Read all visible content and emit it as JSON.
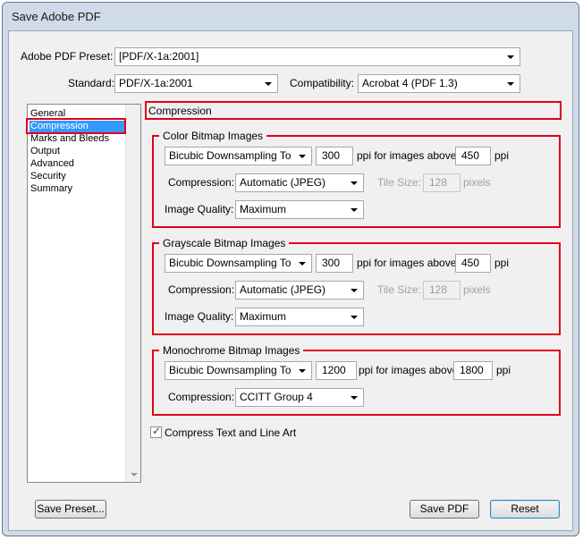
{
  "window": {
    "title": "Save Adobe PDF"
  },
  "preset": {
    "label": "Adobe PDF Preset:",
    "value": "[PDF/X-1a:2001]"
  },
  "standard": {
    "label": "Standard:",
    "value": "PDF/X-1a:2001"
  },
  "compatibility": {
    "label": "Compatibility:",
    "value": "Acrobat 4 (PDF 1.3)"
  },
  "sidebar": {
    "items": [
      {
        "label": "General",
        "selected": false
      },
      {
        "label": "Compression",
        "selected": true
      },
      {
        "label": "Marks and Bleeds",
        "selected": false
      },
      {
        "label": "Output",
        "selected": false
      },
      {
        "label": "Advanced",
        "selected": false
      },
      {
        "label": "Security",
        "selected": false
      },
      {
        "label": "Summary",
        "selected": false
      }
    ]
  },
  "panel": {
    "title": "Compression"
  },
  "color": {
    "title": "Color Bitmap Images",
    "downsampling": "Bicubic Downsampling To",
    "ppi": "300",
    "ppi_label": "ppi for images above",
    "above": "450",
    "ppi_unit": "ppi",
    "compression_label": "Compression:",
    "compression": "Automatic (JPEG)",
    "tile_label": "Tile Size:",
    "tile": "128",
    "tile_unit": "pixels",
    "quality_label": "Image Quality:",
    "quality": "Maximum"
  },
  "gray": {
    "title": "Grayscale Bitmap Images",
    "downsampling": "Bicubic Downsampling To",
    "ppi": "300",
    "ppi_label": "ppi for images above",
    "above": "450",
    "ppi_unit": "ppi",
    "compression_label": "Compression:",
    "compression": "Automatic (JPEG)",
    "tile_label": "Tile Size:",
    "tile": "128",
    "tile_unit": "pixels",
    "quality_label": "Image Quality:",
    "quality": "Maximum"
  },
  "mono": {
    "title": "Monochrome Bitmap Images",
    "downsampling": "Bicubic Downsampling To",
    "ppi": "1200",
    "ppi_label": "ppi for images above",
    "above": "1800",
    "ppi_unit": "ppi",
    "compression_label": "Compression:",
    "compression": "CCITT Group 4"
  },
  "compress_text": {
    "label": "Compress Text and Line Art",
    "checked": true
  },
  "buttons": {
    "save_preset": "Save Preset...",
    "save_pdf": "Save PDF",
    "reset": "Reset"
  },
  "colors": {
    "highlight": "#e0001a",
    "selection": "#3399ff"
  }
}
